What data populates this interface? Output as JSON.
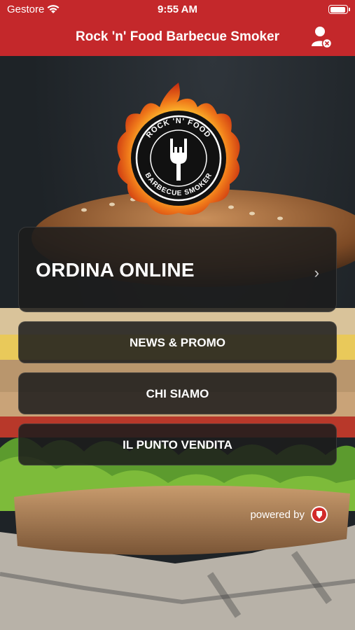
{
  "status": {
    "carrier": "Gestore",
    "time": "9:55 AM"
  },
  "nav": {
    "title": "Rock 'n' Food Barbecue Smoker"
  },
  "logo": {
    "text_top": "ROCK 'N' FOOD",
    "text_bottom": "BARBECUE SMOKER"
  },
  "menu": {
    "main_label": "ORDINA ONLINE",
    "chevron": "›",
    "items": [
      "NEWS & PROMO",
      "CHI SIAMO",
      "IL PUNTO VENDITA"
    ]
  },
  "footer": {
    "powered_by": "powered by"
  },
  "colors": {
    "brand": "#c4282b",
    "button_bg": "#1c1c1c"
  }
}
